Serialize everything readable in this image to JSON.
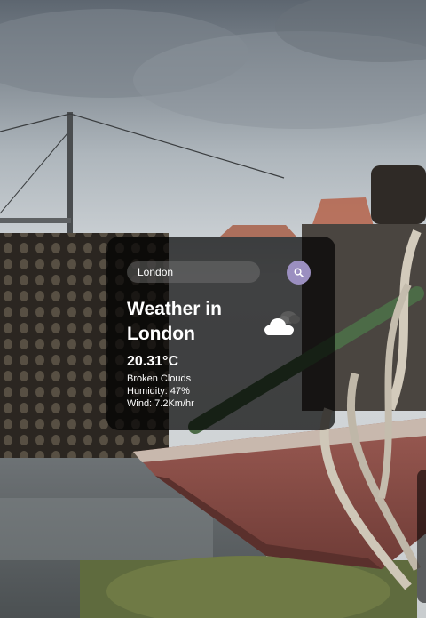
{
  "search": {
    "value": "London",
    "placeholder": "Search"
  },
  "weather": {
    "title": "Weather in London",
    "temperature": "20.31°C",
    "description": "Broken Clouds",
    "humidity": "Humidity: 47%",
    "wind": "Wind: 7.2Km/hr",
    "icon": "broken-clouds-icon"
  },
  "icons": {
    "search": "search-icon"
  },
  "colors": {
    "card_background": "#000000",
    "search_button": "#9b8fc0",
    "text": "#ffffff"
  }
}
